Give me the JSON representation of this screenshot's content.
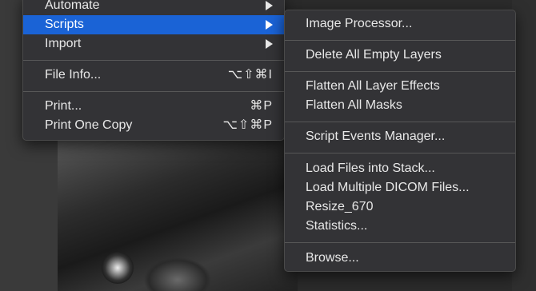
{
  "main_menu": {
    "items": [
      {
        "label": "Automate",
        "shortcut": ""
      },
      {
        "label": "Scripts",
        "shortcut": ""
      },
      {
        "label": "Import",
        "shortcut": ""
      },
      {
        "label": "File Info...",
        "shortcut": "⌥⇧⌘I"
      },
      {
        "label": "Print...",
        "shortcut": "⌘P"
      },
      {
        "label": "Print One Copy",
        "shortcut": "⌥⇧⌘P"
      }
    ],
    "selected": "Scripts"
  },
  "scripts_submenu": {
    "items": [
      {
        "label": "Image Processor..."
      },
      {
        "label": "Delete All Empty Layers"
      },
      {
        "label": "Flatten All Layer Effects"
      },
      {
        "label": "Flatten All Masks"
      },
      {
        "label": "Script Events Manager..."
      },
      {
        "label": "Load Files into Stack..."
      },
      {
        "label": "Load Multiple DICOM Files..."
      },
      {
        "label": "Resize_670"
      },
      {
        "label": "Statistics..."
      },
      {
        "label": "Browse..."
      }
    ]
  },
  "colors": {
    "selection": "#1a63d6",
    "menu_bg": "#333336",
    "text": "#e8e8e8"
  }
}
